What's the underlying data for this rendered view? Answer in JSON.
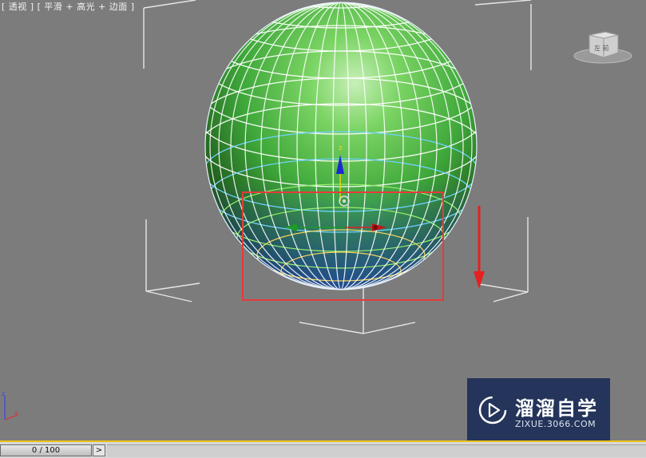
{
  "viewport": {
    "label": "[ 透视 ] [ 平滑 + 高光 + 边面 ]",
    "navcube_face": "左 前"
  },
  "colors": {
    "viewport_bg": "#7c7c7c",
    "sphere_green": "#3fa83a",
    "wire": "#ffffff",
    "selection_box": "#e83a3a",
    "arrow": "#e62020",
    "watermark_bg": "#24345a",
    "timebar_accent": "#e9c21a"
  },
  "icons": {
    "navcube": "view-cube-icon",
    "gizmo": "move-gizmo-icon",
    "axis": "axis-tripod-icon",
    "watermark": "play-logo-icon"
  },
  "axes": {
    "z": "z",
    "x": "x"
  },
  "watermark": {
    "title": "溜溜自学",
    "url": "ZIXUE.3066.COM"
  },
  "timeline": {
    "frame": "0 / 100",
    "next": ">"
  }
}
